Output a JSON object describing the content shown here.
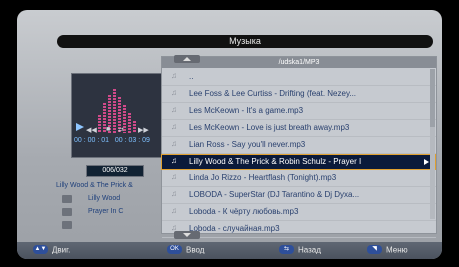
{
  "header": {
    "title": "Музыка"
  },
  "player": {
    "elapsed": "00 : 00 : 01",
    "duration": "00 : 03 : 09",
    "track_counter": "006/032",
    "info_title": "Lilly Wood & The Prick &",
    "info_artist": "Lilly Wood",
    "info_album": "Prayer In C"
  },
  "browser": {
    "path": "/udska1/MP3",
    "rows": [
      {
        "label": "..",
        "selected": false
      },
      {
        "label": "Lee Foss & Lee Curtiss - Drifting (feat. Nezey...",
        "selected": false
      },
      {
        "label": "Les McKeown - It's a game.mp3",
        "selected": false
      },
      {
        "label": "Les McKeown - Love is just breath away.mp3",
        "selected": false
      },
      {
        "label": "Lian Ross - Say you'll never.mp3",
        "selected": false
      },
      {
        "label": "Lilly Wood & The Prick & Robin Schulz - Prayer I",
        "selected": true
      },
      {
        "label": "Linda Jo Rizzo - Heartflash (Tonight).mp3",
        "selected": false
      },
      {
        "label": "LOBODA - SuperStar (DJ Tarantino & Dj Dyxa...",
        "selected": false
      },
      {
        "label": "Loboda - К чёрту любовь.mp3",
        "selected": false
      },
      {
        "label": "Loboda - случайная.mp3",
        "selected": false
      }
    ],
    "scroll_position": 0.0
  },
  "footer": {
    "move": {
      "key": "▲▼",
      "label": "Двиг."
    },
    "enter": {
      "key": "OK",
      "label": "Ввод"
    },
    "back": {
      "key": "⇆",
      "label": "Назад"
    },
    "menu": {
      "key": "◥",
      "label": "Меню"
    }
  }
}
